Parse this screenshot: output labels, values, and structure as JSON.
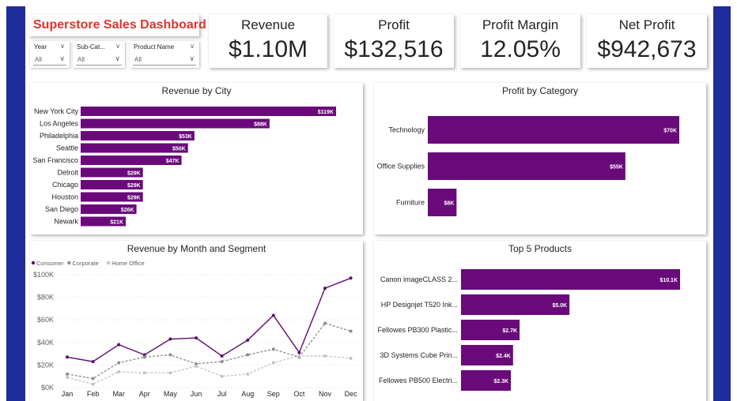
{
  "dashboard_title": "Superstore Sales Dashboard",
  "colors": {
    "accent_bar": "#1f2c9c",
    "title": "#e0342a",
    "bar": "#6a0a7a",
    "consumer": "#5c0a6e",
    "corporate": "#8c8c8c",
    "home_office": "#c4c4c4"
  },
  "slicers": [
    {
      "label": "Year",
      "value": "All"
    },
    {
      "label": "Sub-Cat...",
      "value": "All"
    },
    {
      "label": "Product Name",
      "value": "All"
    }
  ],
  "kpis": [
    {
      "label": "Revenue",
      "value": "$1.10M"
    },
    {
      "label": "Profit",
      "value": "$132,516"
    },
    {
      "label": "Profit Margin",
      "value": "12.05%"
    },
    {
      "label": "Net Profit",
      "value": "$942,673"
    }
  ],
  "revenue_by_city": {
    "title": "Revenue by City",
    "chart_data": {
      "type": "bar",
      "orientation": "horizontal",
      "categories": [
        "New York City",
        "Los Angeles",
        "Philadelphia",
        "Seattle",
        "San Francisco",
        "Detroit",
        "Chicago",
        "Houston",
        "San Diego",
        "Newark"
      ],
      "values": [
        119,
        88,
        53,
        50,
        47,
        29,
        29,
        29,
        26,
        21
      ],
      "labels": [
        "$119K",
        "$88K",
        "$53K",
        "$50K",
        "$47K",
        "$29K",
        "$29K",
        "$29K",
        "$26K",
        "$21K"
      ],
      "unit": "$K"
    }
  },
  "profit_by_category": {
    "title": "Profit by Category",
    "chart_data": {
      "type": "bar",
      "orientation": "horizontal",
      "categories": [
        "Technology",
        "Office Supplies",
        "Furniture"
      ],
      "values": [
        70,
        55,
        8
      ],
      "labels": [
        "$70K",
        "$55K",
        "$8K"
      ],
      "unit": "$K"
    }
  },
  "revenue_by_month": {
    "title": "Revenue by Month and Segment",
    "chart_data": {
      "type": "line",
      "x": [
        "Jan",
        "Feb",
        "Mar",
        "Apr",
        "May",
        "Jun",
        "Jul",
        "Aug",
        "Sep",
        "Oct",
        "Nov",
        "Dec"
      ],
      "y_ticks": [
        "$0K",
        "$20K",
        "$40K",
        "$60K",
        "$80K",
        "$100K"
      ],
      "ylim": [
        0,
        100
      ],
      "legend_position": "top-left",
      "series": [
        {
          "name": "Consumer",
          "values": [
            27,
            23,
            38,
            29,
            43,
            44,
            28,
            42,
            64,
            31,
            88,
            97
          ]
        },
        {
          "name": "Corporate",
          "values": [
            12,
            8,
            22,
            27,
            29,
            21,
            23,
            29,
            34,
            27,
            57,
            50
          ]
        },
        {
          "name": "Home Office",
          "values": [
            9,
            3,
            14,
            13,
            13,
            19,
            10,
            12,
            22,
            28,
            28,
            26
          ]
        }
      ]
    }
  },
  "top_products": {
    "title": "Top 5 Products",
    "chart_data": {
      "type": "bar",
      "orientation": "horizontal",
      "categories": [
        "Canon imageCLASS 2...",
        "HP Designjet T520 Ink...",
        "Fellowes PB300 Plastic...",
        "3D Systems Cube Prin...",
        "Fellowes PB500 Electri..."
      ],
      "values": [
        10.1,
        5.0,
        2.7,
        2.4,
        2.3
      ],
      "labels": [
        "$10.1K",
        "$5.0K",
        "$2.7K",
        "$2.4K",
        "$2.3K"
      ],
      "unit": "$K"
    }
  }
}
